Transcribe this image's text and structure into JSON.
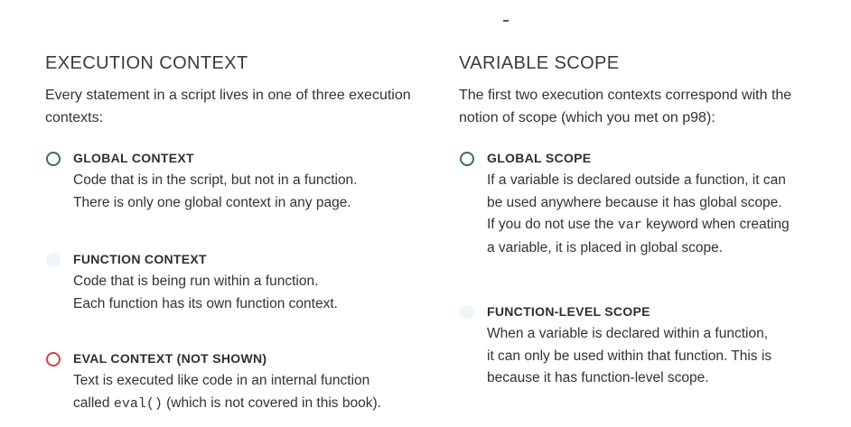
{
  "execution_context": {
    "title": "EXECUTION CONTEXT",
    "intro": "Every statement in a script lives in one of three execution contexts:",
    "items": [
      {
        "heading": "GLOBAL CONTEXT",
        "body_lines": [
          "Code that is in the script, but not in a function.",
          "There is only one global context in any page."
        ]
      },
      {
        "heading": "FUNCTION CONTEXT",
        "body_lines": [
          "Code that is being run within a function.",
          "Each function has its own function context."
        ]
      },
      {
        "heading": "EVAL CONTEXT (NOT SHOWN)",
        "body_line1": "Text is executed like code in an internal function",
        "body_line2_pre": "called ",
        "body_line2_code": "eval()",
        "body_line2_post": " (which is not covered in this book)."
      }
    ]
  },
  "variable_scope": {
    "title": "VARIABLE SCOPE",
    "intro_line1": "The first two execution contexts correspond with the",
    "intro_line2": "notion of scope (which you met on p98):",
    "items": [
      {
        "heading": "GLOBAL SCOPE",
        "body_line1": "If a variable is declared outside a function, it can",
        "body_line2": "be used anywhere because it has global scope.",
        "body_line3_pre": "If you do not use the ",
        "body_line3_code": "var",
        "body_line3_post": " keyword when creating",
        "body_line4": "a variable, it is placed in global scope."
      },
      {
        "heading": "FUNCTION-LEVEL SCOPE",
        "body_lines": [
          "When a variable is declared within a function,",
          "it can only be used within that function. This is",
          "because it has function-level scope."
        ]
      }
    ]
  },
  "colors": {
    "global_circle": "#3a6b66",
    "eval_circle": "#c8453e",
    "faint_circle": "#eef5f8"
  }
}
